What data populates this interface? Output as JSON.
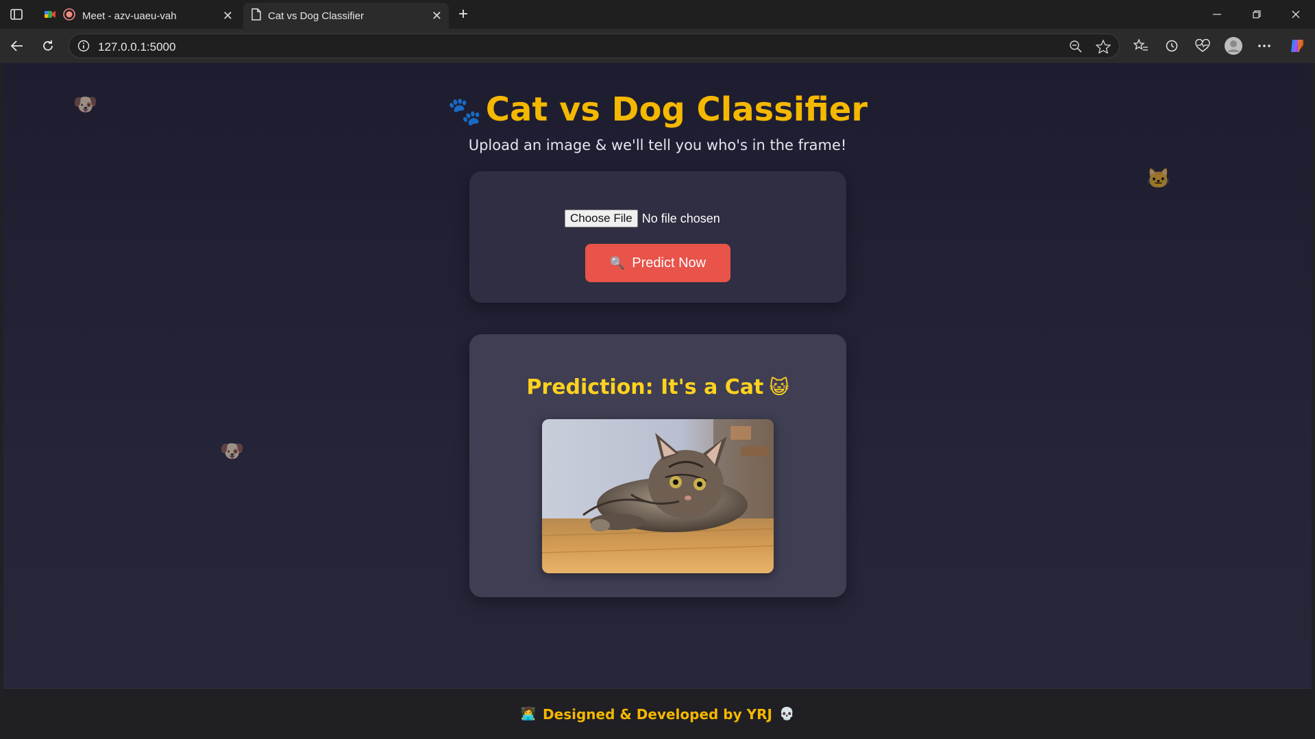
{
  "browser": {
    "tabs": [
      {
        "title": "Meet - azv-uaeu-vah",
        "active": false
      },
      {
        "title": "Cat vs Dog Classifier",
        "active": true
      }
    ],
    "url": "127.0.0.1:5000",
    "new_tab_symbol": "+",
    "close_symbol": "✕"
  },
  "page": {
    "heading": "Cat vs Dog Classifier",
    "heading_icon": "🐾",
    "subtitle": "Upload an image & we'll tell you who's in the frame!",
    "upload": {
      "choose_file_label": "Choose File",
      "file_status": "No file chosen"
    },
    "predict_button": {
      "icon": "🔍",
      "label": "Predict Now"
    },
    "prediction": {
      "text": "Prediction: It's a Cat",
      "emoji": "😺"
    },
    "floating_emojis": [
      "🐶",
      "🐱",
      "🐶"
    ],
    "footer": {
      "prefix_icon": "👩‍💻",
      "text": "Designed & Developed by YRJ",
      "suffix_icon": "💀"
    }
  },
  "colors": {
    "accent": "#f5b800",
    "prediction": "#ffd21e",
    "button": "#e8534a",
    "page_bg": "#1e1d30"
  }
}
